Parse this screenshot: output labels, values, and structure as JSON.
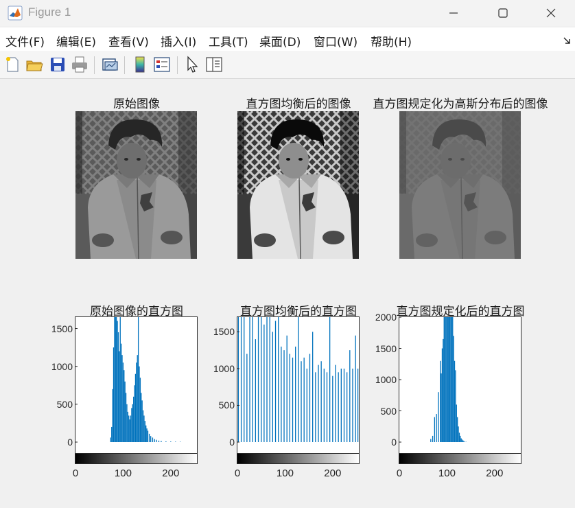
{
  "window": {
    "title": "Figure 1",
    "buttons": [
      "minimize",
      "maximize",
      "close"
    ]
  },
  "menubar": {
    "items": [
      "文件(F)",
      "编辑(E)",
      "查看(V)",
      "插入(I)",
      "工具(T)",
      "桌面(D)",
      "窗口(W)",
      "帮助(H)"
    ]
  },
  "toolbar": {
    "buttons": [
      "new-figure-icon",
      "open-file-icon",
      "save-icon",
      "print-icon",
      "link-plot-icon",
      "insert-colorbar-icon",
      "insert-legend-icon",
      "edit-plot-arrow-icon",
      "property-inspector-icon"
    ]
  },
  "images": [
    {
      "title": "原始图像",
      "tone": "original"
    },
    {
      "title": "直方图均衡后的图像",
      "tone": "equalized"
    },
    {
      "title": "直方图规定化为高斯分布后的图像",
      "tone": "specified"
    }
  ],
  "chart_data": [
    {
      "type": "bar",
      "title": "原始图像的直方图",
      "xlim": [
        0,
        255
      ],
      "ylim": [
        0,
        1650
      ],
      "yticks": [
        "0",
        "500",
        "1000",
        "1500"
      ],
      "xticks": [
        "0",
        "100",
        "200"
      ],
      "bar_color": "#0072bd",
      "x": [
        74,
        76,
        78,
        80,
        82,
        84,
        86,
        88,
        90,
        92,
        94,
        96,
        98,
        100,
        102,
        104,
        106,
        108,
        110,
        112,
        114,
        116,
        118,
        120,
        122,
        124,
        126,
        128,
        130,
        132,
        134,
        136,
        138,
        140,
        142,
        144,
        146,
        148,
        150,
        152,
        155,
        158,
        162,
        166,
        170,
        175,
        180,
        190,
        200,
        210,
        220
      ],
      "values": [
        60,
        200,
        700,
        1250,
        1650,
        1650,
        1650,
        1600,
        1450,
        1200,
        1650,
        1300,
        1150,
        1050,
        950,
        800,
        650,
        500,
        400,
        350,
        300,
        350,
        450,
        500,
        600,
        750,
        900,
        1050,
        1150,
        1650,
        1000,
        850,
        650,
        550,
        420,
        350,
        280,
        220,
        180,
        150,
        110,
        80,
        60,
        40,
        30,
        20,
        15,
        10,
        8,
        6,
        5
      ]
    },
    {
      "type": "bar",
      "title": "直方图均衡后的直方图",
      "xlim": [
        0,
        255
      ],
      "ylim": [
        0,
        1700
      ],
      "yticks": [
        "0",
        "500",
        "1000",
        "1500"
      ],
      "xticks": [
        "0",
        "100",
        "200"
      ],
      "bar_color": "#0072bd",
      "x": [
        2,
        8,
        14,
        20,
        26,
        32,
        38,
        44,
        50,
        56,
        62,
        68,
        74,
        80,
        86,
        92,
        98,
        104,
        110,
        116,
        122,
        128,
        134,
        140,
        146,
        152,
        158,
        164,
        170,
        176,
        182,
        188,
        194,
        200,
        206,
        212,
        218,
        224,
        230,
        236,
        242,
        248,
        253
      ],
      "values": [
        1700,
        1700,
        1700,
        1200,
        1700,
        1700,
        1400,
        1700,
        1700,
        1600,
        1700,
        1700,
        1500,
        1650,
        1700,
        1300,
        1250,
        1450,
        1200,
        1150,
        1300,
        1700,
        1100,
        1150,
        1000,
        1200,
        1500,
        950,
        1050,
        1100,
        1000,
        950,
        1700,
        900,
        1050,
        950,
        1000,
        1000,
        950,
        1250,
        1000,
        1450,
        1000
      ]
    },
    {
      "type": "bar",
      "title": "直方图规定化后的直方图",
      "xlim": [
        0,
        255
      ],
      "ylim": [
        0,
        2000
      ],
      "yticks": [
        "0",
        "500",
        "1000",
        "1500",
        "2000"
      ],
      "xticks": [
        "0",
        "100",
        "200"
      ],
      "bar_color": "#0072bd",
      "x": [
        66,
        70,
        74,
        78,
        82,
        86,
        88,
        90,
        92,
        94,
        96,
        98,
        100,
        102,
        104,
        106,
        108,
        110,
        112,
        114,
        116,
        118,
        120,
        122,
        124,
        126,
        128,
        130,
        132,
        134,
        136,
        140
      ],
      "values": [
        50,
        100,
        400,
        450,
        800,
        1300,
        1100,
        1500,
        1650,
        2000,
        2000,
        2000,
        2000,
        2000,
        2000,
        2000,
        2000,
        2000,
        2000,
        1700,
        1300,
        1150,
        600,
        400,
        250,
        150,
        100,
        60,
        40,
        25,
        15,
        5
      ]
    }
  ]
}
